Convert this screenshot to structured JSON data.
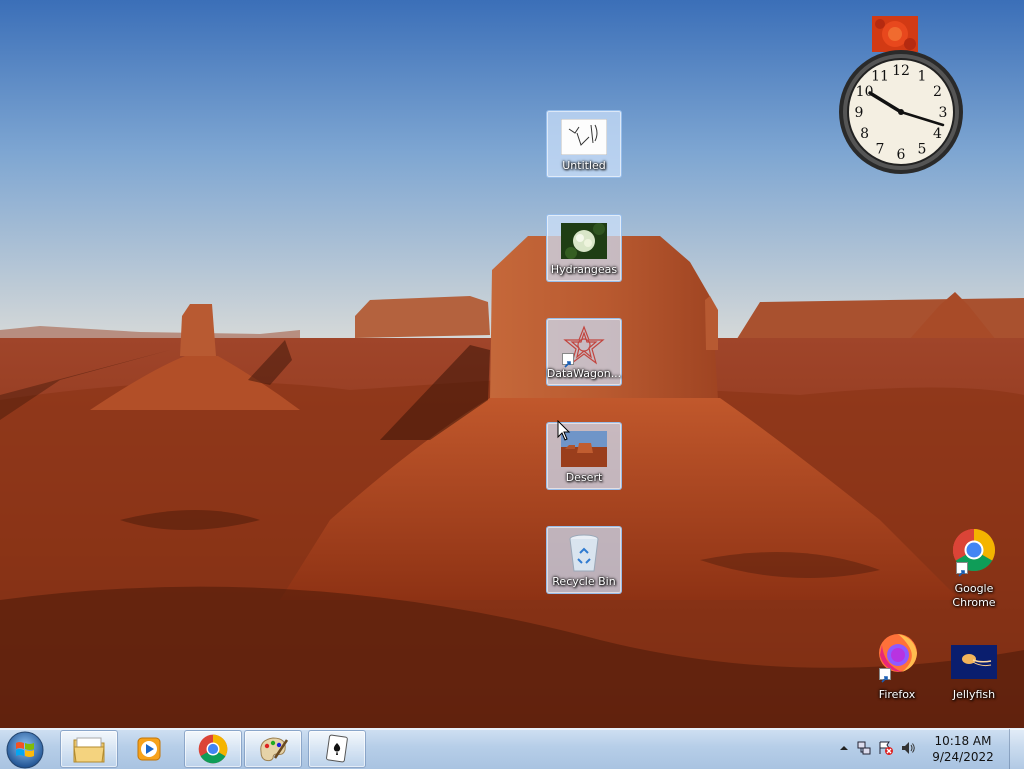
{
  "desktop": {
    "icons": [
      {
        "name": "icon-untitled",
        "label": "Untitled"
      },
      {
        "name": "icon-hydrangeas",
        "label": "Hydrangeas"
      },
      {
        "name": "icon-datawagon",
        "label": "DataWagon..."
      },
      {
        "name": "icon-desert",
        "label": "Desert"
      },
      {
        "name": "icon-recycle-bin",
        "label": "Recycle Bin"
      },
      {
        "name": "icon-google-chrome",
        "label": "Google Chrome"
      },
      {
        "name": "icon-firefox",
        "label": "Firefox"
      },
      {
        "name": "icon-jellyfish",
        "label": "Jellyfish"
      }
    ]
  },
  "clock_gadget": {
    "numerals": [
      "12",
      "1",
      "2",
      "3",
      "4",
      "5",
      "6",
      "7",
      "8",
      "9",
      "10",
      "11"
    ],
    "time": "10:18"
  },
  "taskbar": {
    "start_icon": "windows-logo-icon",
    "pinned": [
      {
        "icon": "file-explorer-icon"
      },
      {
        "icon": "media-player-icon"
      },
      {
        "icon": "chrome-icon"
      },
      {
        "icon": "paint-icon"
      },
      {
        "icon": "solitaire-icon"
      }
    ],
    "tray": {
      "icons": [
        "show-hidden-icons-icon",
        "network-icon",
        "action-center-icon",
        "volume-icon"
      ],
      "time": "10:18 AM",
      "date": "9/24/2022"
    }
  },
  "colors": {
    "sky_top": "#3f72b8",
    "sky_bottom": "#c9d8e4",
    "rock": "#b8532a",
    "taskbar": "#b6cee8"
  }
}
